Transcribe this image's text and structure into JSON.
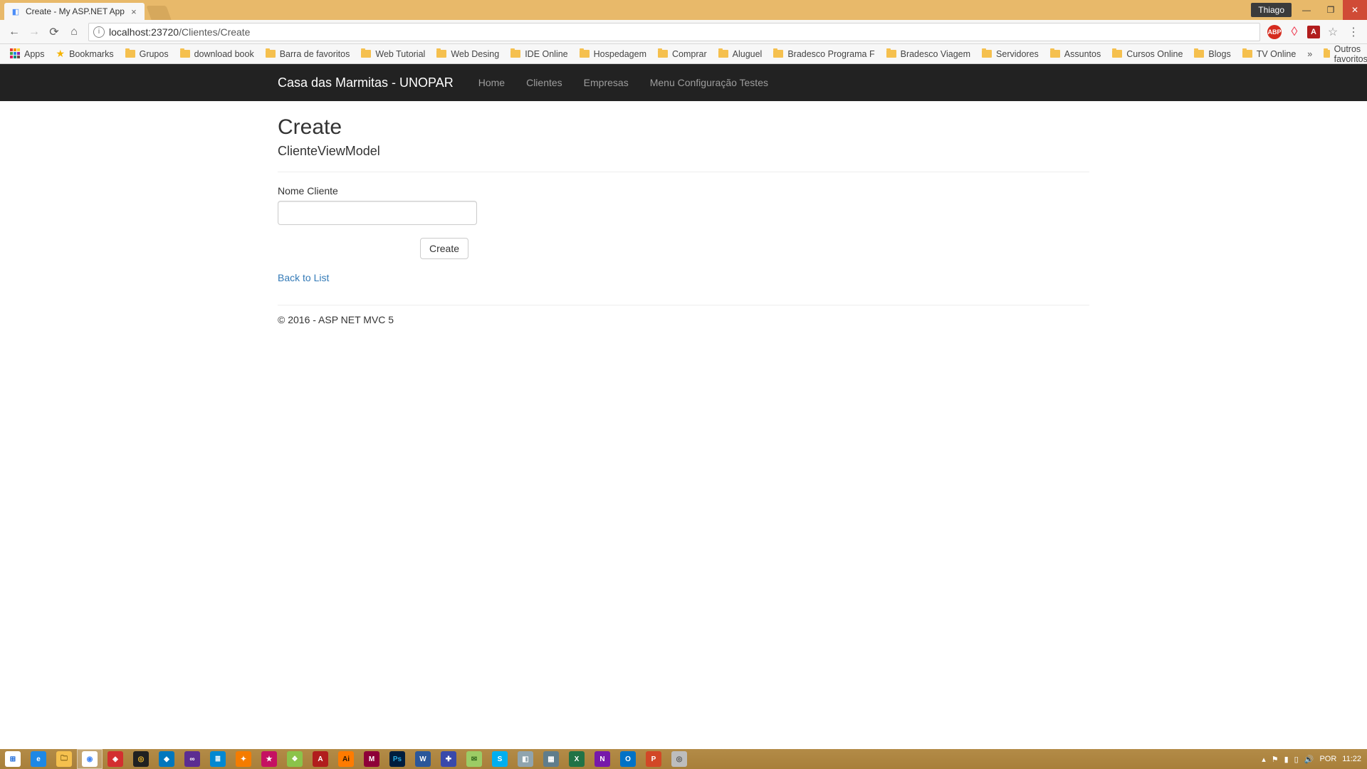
{
  "chrome": {
    "user": "Thiago",
    "tab_title": "Create - My ASP.NET App",
    "url_host": "localhost",
    "url_port": ":23720",
    "url_path": "/Clientes/Create"
  },
  "bookmarks": {
    "apps": "Apps",
    "bookmarks": "Bookmarks",
    "items": [
      "Grupos",
      "download book",
      "Barra de favoritos",
      "Web Tutorial",
      "Web Desing",
      "IDE Online",
      "Hospedagem",
      "Comprar",
      "Aluguel",
      "Bradesco Programa F",
      "Bradesco Viagem",
      "Servidores",
      "Assuntos",
      "Cursos Online",
      "Blogs",
      "TV Online"
    ],
    "other": "Outros favoritos"
  },
  "app_nav": {
    "brand": "Casa das Marmitas - UNOPAR",
    "links": [
      "Home",
      "Clientes",
      "Empresas",
      "Menu Configuração Testes"
    ]
  },
  "page": {
    "title": "Create",
    "subtitle": "ClienteViewModel",
    "label_nome": "Nome Cliente",
    "input_value": "",
    "submit": "Create",
    "back": "Back to List",
    "footer": "© 2016 - ASP NET MVC 5"
  },
  "taskbar": {
    "lang": "POR",
    "time": "11:22"
  }
}
